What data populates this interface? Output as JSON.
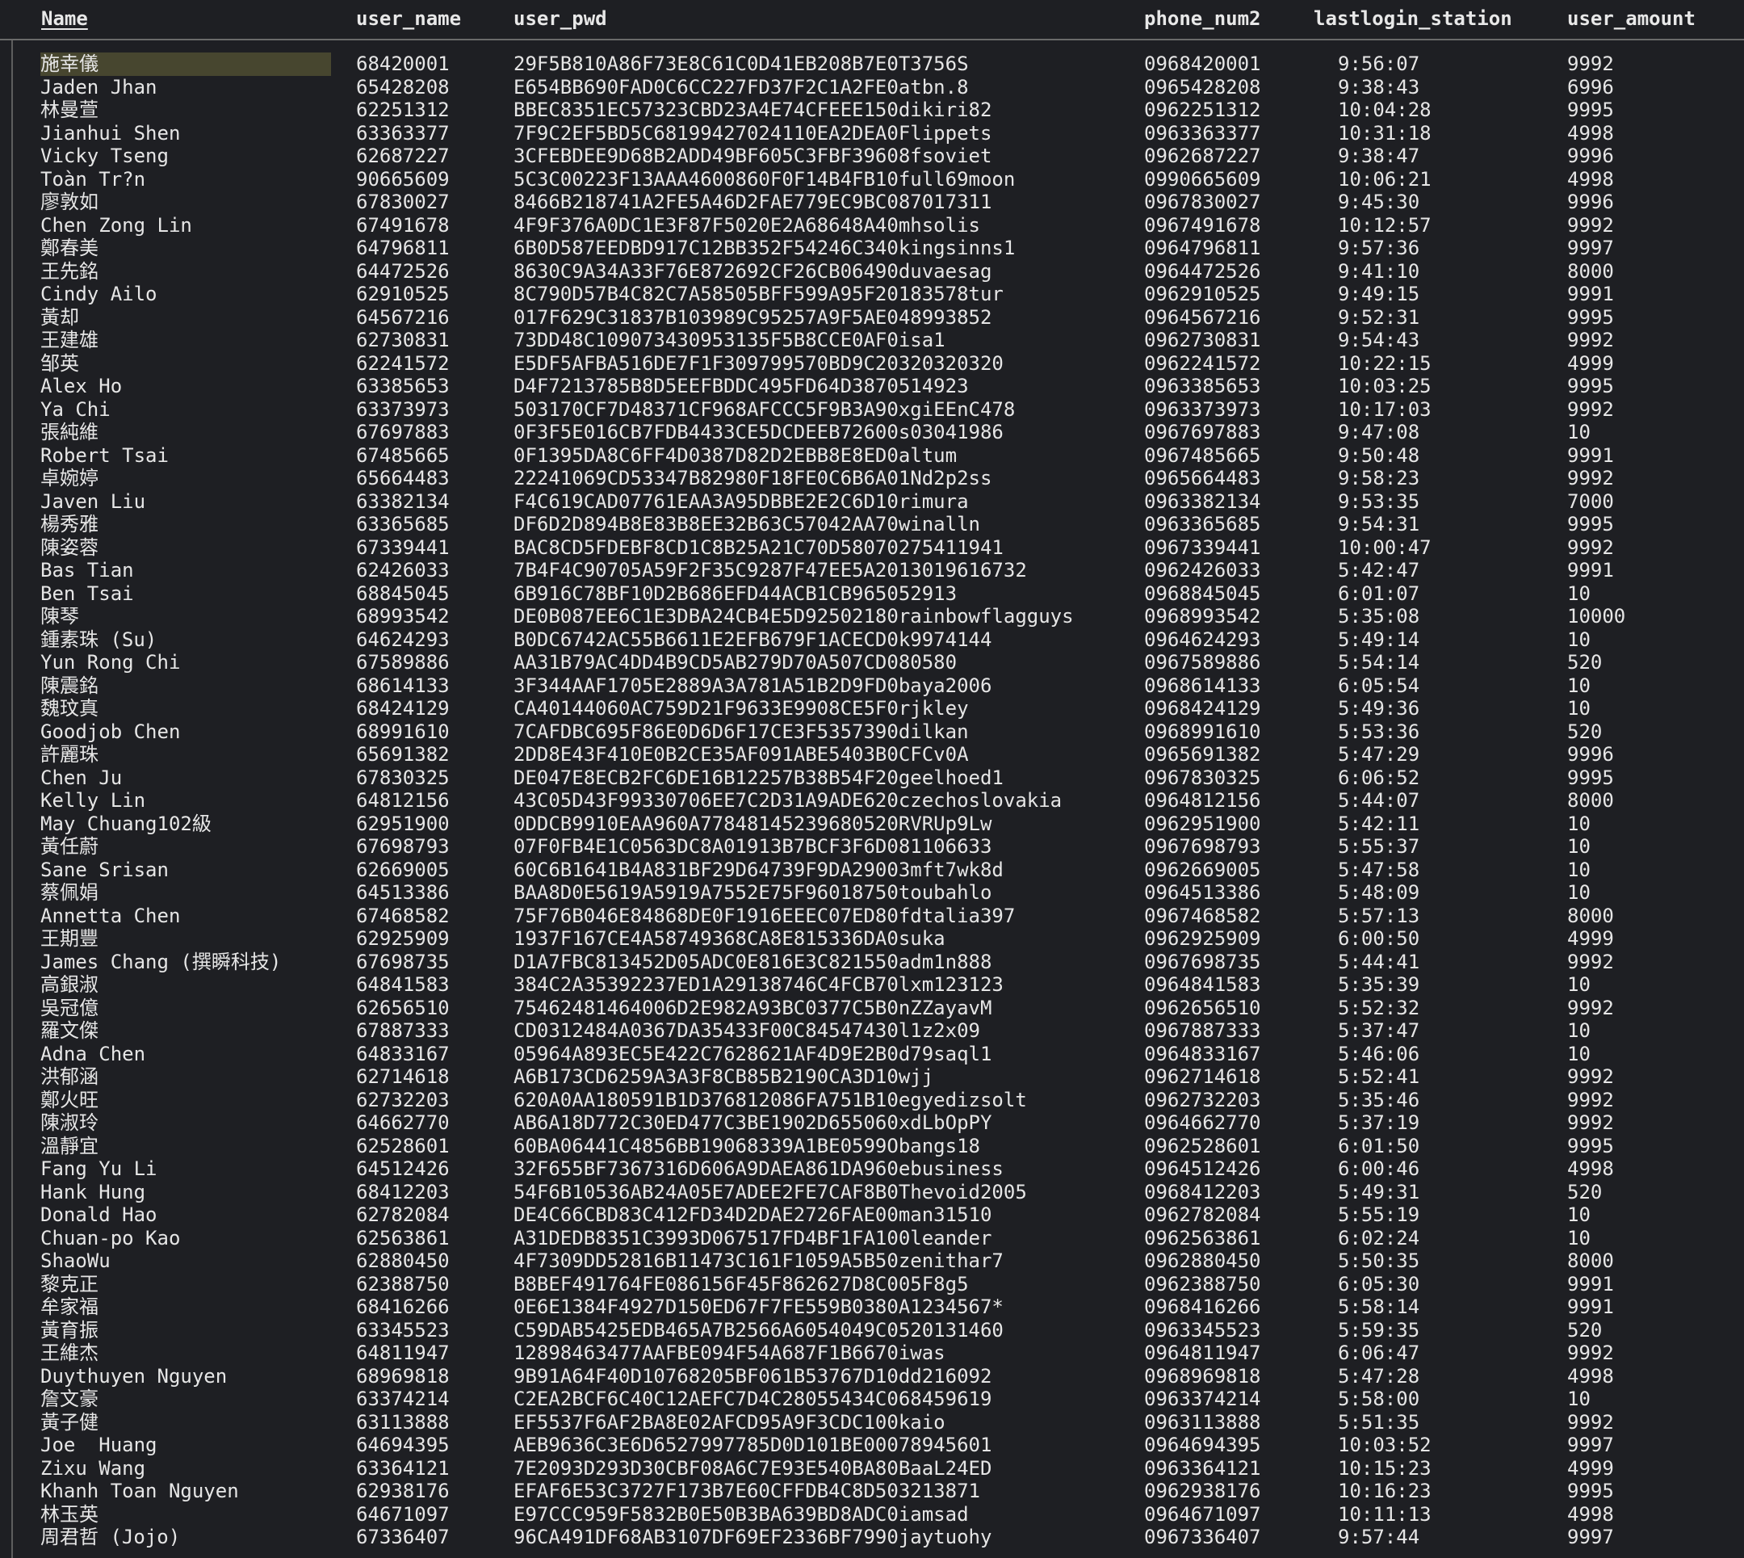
{
  "table": {
    "columns": [
      {
        "key": "name",
        "label": "Name",
        "sorted": true
      },
      {
        "key": "user_name",
        "label": "user_name"
      },
      {
        "key": "user_pwd",
        "label": "user_pwd"
      },
      {
        "key": "phone_num2",
        "label": "phone_num2"
      },
      {
        "key": "lastlogin_station",
        "label": "lastlogin_station"
      },
      {
        "key": "user_amount",
        "label": "user_amount"
      }
    ],
    "rows": [
      [
        "施幸儀",
        "68420001",
        "29F5B810A86F73E8C61C0D41EB208B7E0T3756S",
        "0968420001",
        "9:56:07",
        "9992"
      ],
      [
        "Jaden Jhan",
        "65428208",
        "E654BB690FAD0C6CC227FD37F2C1A2FE0atbn.8",
        "0965428208",
        "9:38:43",
        "6996"
      ],
      [
        "林曼萱",
        "62251312",
        "BBEC8351EC57323CBD23A4E74CFEEE150dikiri82",
        "0962251312",
        "10:04:28",
        "9995"
      ],
      [
        "Jianhui Shen",
        "63363377",
        "7F9C2EF5BD5C68199427024110EA2DEA0Flippets",
        "0963363377",
        "10:31:18",
        "4998"
      ],
      [
        "Vicky Tseng",
        "62687227",
        "3CFEBDEE9D68B2ADD49BF605C3FBF39608fsoviet",
        "0962687227",
        "9:38:47",
        "9996"
      ],
      [
        "Toàn Tr?n",
        "90665609",
        "5C3C00223F13AAA4600860F0F14B4FB10full69moon",
        "0990665609",
        "10:06:21",
        "4998"
      ],
      [
        "廖敦如",
        "67830027",
        "8466B218741A2FE5A46D2FAE779EC9BC087017311",
        "0967830027",
        "9:45:30",
        "9996"
      ],
      [
        "Chen Zong Lin",
        "67491678",
        "4F9F376A0DC1E3F87F5020E2A68648A40mhsolis",
        "0967491678",
        "10:12:57",
        "9992"
      ],
      [
        "鄭春美",
        "64796811",
        "6B0D587EEDBD917C12BB352F54246C340kingsinns1",
        "0964796811",
        "9:57:36",
        "9997"
      ],
      [
        "王先銘",
        "64472526",
        "8630C9A34A33F76E872692CF26CB06490duvaesag",
        "0964472526",
        "9:41:10",
        "8000"
      ],
      [
        "Cindy Ailo",
        "62910525",
        "8C790D57B4C82C7A58505BFF599A95F20183578tur",
        "0962910525",
        "9:49:15",
        "9991"
      ],
      [
        "黃却",
        "64567216",
        "017F629C31837B103989C95257A9F5AE048993852",
        "0964567216",
        "9:52:31",
        "9995"
      ],
      [
        "王建雄",
        "62730831",
        "73DD48C109073430953135F5B8CCE0AF0isa1",
        "0962730831",
        "9:54:43",
        "9992"
      ],
      [
        "邹英",
        "62241572",
        "E5DF5AFBA516DE7F1F309799570BD9C20320320320",
        "0962241572",
        "10:22:15",
        "4999"
      ],
      [
        "Alex Ho",
        "63385653",
        "D4F7213785B8D5EEFBDDC495FD64D3870514923",
        "0963385653",
        "10:03:25",
        "9995"
      ],
      [
        "Ya Chi",
        "63373973",
        "503170CF7D48371CF968AFCCC5F9B3A90xgiEEnC478",
        "0963373973",
        "10:17:03",
        "9992"
      ],
      [
        "張純維",
        "67697883",
        "0F3F5E016CB7FDB4433CE5DCDEEB72600s03041986",
        "0967697883",
        "9:47:08",
        "10"
      ],
      [
        "Robert Tsai",
        "67485665",
        "0F1395DA8C6FF4D0387D82D2EBB8E8ED0altum",
        "0967485665",
        "9:50:48",
        "9991"
      ],
      [
        "卓婉婷",
        "65664483",
        "22241069CD53347B82980F18FE0C6B6A01Nd2p2ss",
        "0965664483",
        "9:58:23",
        "9992"
      ],
      [
        "Javen Liu",
        "63382134",
        "F4C619CAD07761EAA3A95DBBE2E2C6D10rimura",
        "0963382134",
        "9:53:35",
        "7000"
      ],
      [
        "楊秀雅",
        "63365685",
        "DF6D2D894B8E83B8EE32B63C57042AA70winalln",
        "0963365685",
        "9:54:31",
        "9995"
      ],
      [
        "陳姿蓉",
        "67339441",
        "BAC8CD5FDEBF8CD1C8B25A21C70D58070275411941",
        "0967339441",
        "10:00:47",
        "9992"
      ],
      [
        "Bas Tian",
        "62426033",
        "7B4F4C90705A59F2F35C9287F47EE5A2013019616732",
        "0962426033",
        "5:42:47",
        "9991"
      ],
      [
        "Ben Tsai",
        "68845045",
        "6B916C78BF10D2B686EFD44ACB1CB965052913",
        "0968845045",
        "6:01:07",
        "10"
      ],
      [
        "陳琴",
        "68993542",
        "DE0B087EE6C1E3DBA24CB4E5D92502180rainbowflagguys",
        "0968993542",
        "5:35:08",
        "10000"
      ],
      [
        "鍾素珠 (Su)",
        "64624293",
        "B0DC6742AC55B6611E2EFB679F1ACECD0k9974144",
        "0964624293",
        "5:49:14",
        "10"
      ],
      [
        "Yun Rong Chi",
        "67589886",
        "AA31B79AC4DD4B9CD5AB279D70A507CD080580",
        "0967589886",
        "5:54:14",
        "520"
      ],
      [
        "陳震銘",
        "68614133",
        "3F344AAF1705E2889A3A781A51B2D9FD0baya2006",
        "0968614133",
        "6:05:54",
        "10"
      ],
      [
        "魏玟真",
        "68424129",
        "CA40144060AC759D21F9633E9908CE5F0rjkley",
        "0968424129",
        "5:49:36",
        "10"
      ],
      [
        "Goodjob Chen",
        "68991610",
        "7CAFDBC695F86E0D6D6F17CE3F5357390dilkan",
        "0968991610",
        "5:53:36",
        "520"
      ],
      [
        "許麗珠",
        "65691382",
        "2DD8E43F410E0B2CE35AF091ABE5403B0CFCv0A",
        "0965691382",
        "5:47:29",
        "9996"
      ],
      [
        "Chen Ju",
        "67830325",
        "DE047E8ECB2FC6DE16B12257B38B54F20geelhoed1",
        "0967830325",
        "6:06:52",
        "9995"
      ],
      [
        "Kelly Lin",
        "64812156",
        "43C05D43F99330706EE7C2D31A9ADE620czechoslovakia",
        "0964812156",
        "5:44:07",
        "8000"
      ],
      [
        "May Chuang102級",
        "62951900",
        "0DDCB9910EAA960A77848145239680520RVRUp9Lw",
        "0962951900",
        "5:42:11",
        "10"
      ],
      [
        "黃任蔚",
        "67698793",
        "07F0FB4E1C0563DC8A01913B7BCF3F6D081106633",
        "0967698793",
        "5:55:37",
        "10"
      ],
      [
        "Sane Srisan",
        "62669005",
        "60C6B1641B4A831BF29D64739F9DA29003mft7wk8d",
        "0962669005",
        "5:47:58",
        "10"
      ],
      [
        "蔡佩娟",
        "64513386",
        "BAA8D0E5619A5919A7552E75F96018750toubahlo",
        "0964513386",
        "5:48:09",
        "10"
      ],
      [
        "Annetta Chen",
        "67468582",
        "75F76B046E84868DE0F1916EEEC07ED80fdtalia397",
        "0967468582",
        "5:57:13",
        "8000"
      ],
      [
        "王期豐",
        "62925909",
        "1937F167CE4A58749368CA8E815336DA0suka",
        "0962925909",
        "6:00:50",
        "4999"
      ],
      [
        "James Chang (撰瞬科技)",
        "67698735",
        "D1A7FBC813452D05ADC0E816E3C821550adm1n888",
        "0967698735",
        "5:44:41",
        "9992"
      ],
      [
        "高銀淑",
        "64841583",
        "384C2A35392237ED1A29138746C4FCB70lxm123123",
        "0964841583",
        "5:35:39",
        "10"
      ],
      [
        "吳冠億",
        "62656510",
        "75462481464006D2E982A93BC0377C5B0nZZayavM",
        "0962656510",
        "5:52:32",
        "9992"
      ],
      [
        "羅文傑",
        "67887333",
        "CD0312484A0367DA35433F00C84547430l1z2x09",
        "0967887333",
        "5:37:47",
        "10"
      ],
      [
        "Adna Chen",
        "64833167",
        "05964A893EC5E422C7628621AF4D9E2B0d79saql1",
        "0964833167",
        "5:46:06",
        "10"
      ],
      [
        "洪郁涵",
        "62714618",
        "A6B173CD6259A3A3F8CB85B2190CA3D10wjj",
        "0962714618",
        "5:52:41",
        "9992"
      ],
      [
        "鄭火旺",
        "62732203",
        "620A0AA180591B1D376812086FA751B10egyedizsolt",
        "0962732203",
        "5:35:46",
        "9992"
      ],
      [
        "陳淑玲",
        "64662770",
        "AB6A18D772C30ED477C3BE1902D655060xdLbOpPY",
        "0964662770",
        "5:37:19",
        "9992"
      ],
      [
        "溫靜宜",
        "62528601",
        "60BA06441C4856BB19068339A1BE0599Obangs18",
        "0962528601",
        "6:01:50",
        "9995"
      ],
      [
        "Fang Yu Li",
        "64512426",
        "32F655BF7367316D606A9DAEA861DA960ebusiness",
        "0964512426",
        "6:00:46",
        "4998"
      ],
      [
        "Hank Hung",
        "68412203",
        "54F6B10536AB24A05E7ADEE2FE7CAF8B0Thevoid2005",
        "0968412203",
        "5:49:31",
        "520"
      ],
      [
        "Donald Hao",
        "62782084",
        "DE4C66CBD83C412FD34D2DAE2726FAE00man31510",
        "0962782084",
        "5:55:19",
        "10"
      ],
      [
        "Chuan-po Kao",
        "62563861",
        "A31DEDB8351C3993D067517FD4BF1FA100leander",
        "0962563861",
        "6:02:24",
        "10"
      ],
      [
        "ShaoWu",
        "62880450",
        "4F7309DD52816B11473C161F1059A5B50zenithar7",
        "0962880450",
        "5:50:35",
        "8000"
      ],
      [
        "黎克正",
        "62388750",
        "B8BEF491764FE086156F45F862627D8C005F8g5",
        "0962388750",
        "6:05:30",
        "9991"
      ],
      [
        "牟家福",
        "68416266",
        "0E6E1384F4927D150ED67F7FE559B0380A1234567*",
        "0968416266",
        "5:58:14",
        "9991"
      ],
      [
        "黃育振",
        "63345523",
        "C59DAB5425EDB465A7B2566A6054049C0520131460",
        "0963345523",
        "5:59:35",
        "520"
      ],
      [
        "王維杰",
        "64811947",
        "12898463477AAFBE094F54A687F1B6670iwas",
        "0964811947",
        "6:06:47",
        "9992"
      ],
      [
        "Duythuyen Nguyen",
        "68969818",
        "9B91A64F40D10768205BF061B53767D10dd216092",
        "0968969818",
        "5:47:28",
        "4998"
      ],
      [
        "詹文豪",
        "63374214",
        "C2EA2BCF6C40C12AEFC7D4C28055434C068459619",
        "0963374214",
        "5:58:00",
        "10"
      ],
      [
        "黃子健",
        "63113888",
        "EF5537F6AF2BA8E02AFCD95A9F3CDC100kaio",
        "0963113888",
        "5:51:35",
        "9992"
      ],
      [
        "Joe  Huang",
        "64694395",
        "AEB9636C3E6D6527997785D0D101BE00078945601",
        "0964694395",
        "10:03:52",
        "9997"
      ],
      [
        "Zixu Wang",
        "63364121",
        "7E2093D293D30CBF08A6C7E93E540BA80BaaL24ED",
        "0963364121",
        "10:15:23",
        "4999"
      ],
      [
        "Khanh Toan Nguyen",
        "62938176",
        "EFAF6E53C3727F173B7E60CFFDB4C8D503213871",
        "0962938176",
        "10:16:23",
        "9995"
      ],
      [
        "林玉英",
        "64671097",
        "E97CCC959F5832B0E50B3BA639BD8ADC0iamsad",
        "0964671097",
        "10:11:13",
        "4998"
      ],
      [
        "周君哲 (Jojo)",
        "67336407",
        "96CA491DF68AB3107DF69EF2336BF7990jaytuohy",
        "0967336407",
        "9:57:44",
        "9997"
      ]
    ]
  }
}
